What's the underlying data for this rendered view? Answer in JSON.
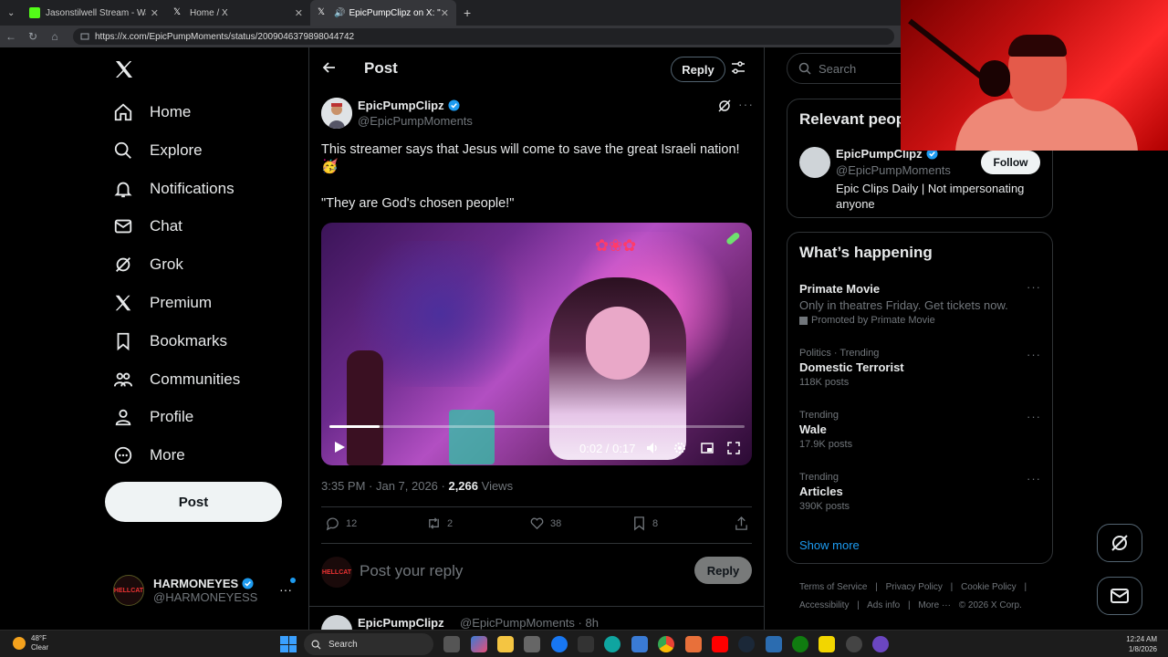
{
  "browser": {
    "tabs": [
      {
        "title": "Jasonstilwell Stream - Watch",
        "favicon_color": "#53fc18"
      },
      {
        "title": "Home / X",
        "favicon_color": "#ffffff"
      },
      {
        "title": "EpicPumpClipz on X: \"This str",
        "favicon_color": "#ffffff"
      }
    ],
    "url": "https://x.com/EpicPumpMoments/status/2009046379898044742"
  },
  "sidebar": {
    "items": [
      {
        "label": "Home",
        "icon": "home-icon"
      },
      {
        "label": "Explore",
        "icon": "search-icon"
      },
      {
        "label": "Notifications",
        "icon": "bell-icon"
      },
      {
        "label": "Chat",
        "icon": "mail-icon"
      },
      {
        "label": "Grok",
        "icon": "grok-icon"
      },
      {
        "label": "Premium",
        "icon": "x-icon"
      },
      {
        "label": "Bookmarks",
        "icon": "bookmark-icon"
      },
      {
        "label": "Communities",
        "icon": "people-icon"
      },
      {
        "label": "Profile",
        "icon": "person-icon"
      },
      {
        "label": "More",
        "icon": "more-circle-icon"
      }
    ],
    "post_button": "Post",
    "account": {
      "name": "HARMONEYES",
      "handle": "@HARMONEYESS",
      "avatar_text": "HELLCAT"
    }
  },
  "main": {
    "header_title": "Post",
    "reply_button": "Reply",
    "author": {
      "name": "EpicPumpClipz",
      "handle": "@EpicPumpMoments"
    },
    "text": "This streamer says that Jesus will come to save the great Israeli nation!",
    "emoji": "🥳",
    "quote": "\"They are God's chosen people!\"",
    "video": {
      "time": "0:02 / 0:17",
      "progress": 0.12
    },
    "meta": {
      "time": "3:35 PM · Jan 7, 2026 · ",
      "views_count": "2,266",
      "views_label": " Views"
    },
    "actions": {
      "replies": "12",
      "reposts": "2",
      "likes": "38",
      "bookmarks": "8"
    },
    "reply_placeholder": "Post your reply",
    "reply_submit": "Reply",
    "next_post": {
      "name": "EpicPumpClipz",
      "handle": "@EpicPumpMoments · 8h"
    }
  },
  "right": {
    "search_placeholder": "Search",
    "relevant": {
      "title": "Relevant peop",
      "name": "EpicPumpClipz",
      "handle": "@EpicPumpMoments",
      "bio": "Epic Clips Daily | Not impersonating anyone",
      "follow": "Follow"
    },
    "happening": {
      "title": "What’s happening",
      "trends": [
        {
          "context": "",
          "title": "Primate Movie",
          "desc": "Only in theatres Friday. Get tickets now.",
          "promo": "Promoted by Primate Movie"
        },
        {
          "context": "Politics · Trending",
          "title": "Domestic Terrorist",
          "sub": "118K posts"
        },
        {
          "context": "Trending",
          "title": "Wale",
          "sub": "17.9K posts"
        },
        {
          "context": "Trending",
          "title": "Articles",
          "sub": "390K posts"
        }
      ],
      "show_more": "Show more"
    },
    "footer": [
      "Terms of Service",
      "|",
      "Privacy Policy",
      "|",
      "Cookie Policy",
      "|",
      "Accessibility",
      "|",
      "Ads info",
      "|",
      "More ···",
      "© 2026 X Corp."
    ]
  },
  "taskbar": {
    "weather_temp": "48°F",
    "weather_desc": "Clear",
    "search": "Search",
    "time": "12:24 AM",
    "date": "1/8/2026"
  }
}
